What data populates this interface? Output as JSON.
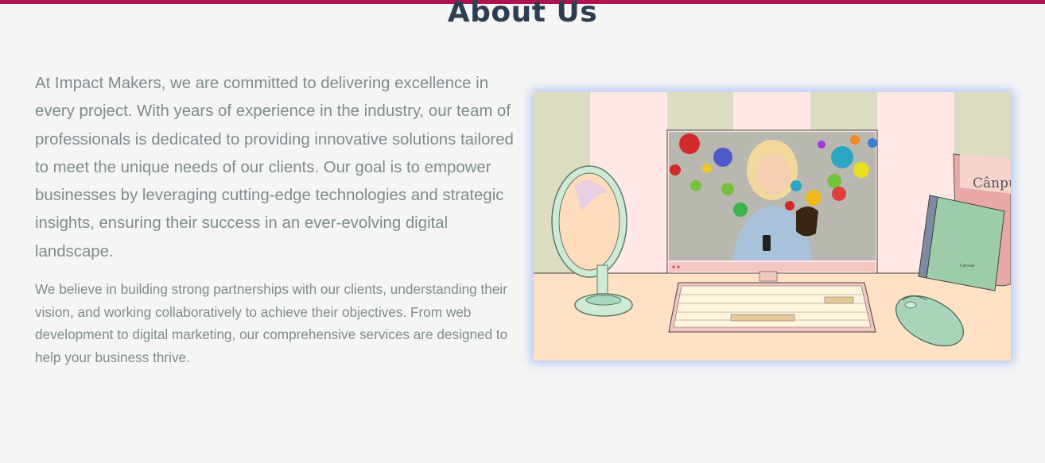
{
  "header": {
    "accent_color": "#b0124f"
  },
  "about": {
    "title": "About Us",
    "paragraph_1": "At Impact Makers, we are committed to delivering excellence in every project. With years of experience in the industry, our team of professionals is dedicated to providing innovative solutions tailored to meet the unique needs of our clients. Our goal is to empower businesses by leveraging cutting-edge technologies and strategic insights, ensuring their success in an ever-evolving digital landscape.",
    "paragraph_2": "We believe in building strong partnerships with our clients, understanding their vision, and working collaboratively to achieve their objectives. From web development to digital marketing, our comprehensive services are designed to help your business thrive."
  },
  "illustration": {
    "book_cover_text": "Cânpu",
    "notebook_label": "Canvas"
  },
  "colors": {
    "title": "#2c3e50",
    "body_text": "#7f8c8d",
    "page_background": "#f5f5f5",
    "image_glow": "#6e96f5"
  }
}
